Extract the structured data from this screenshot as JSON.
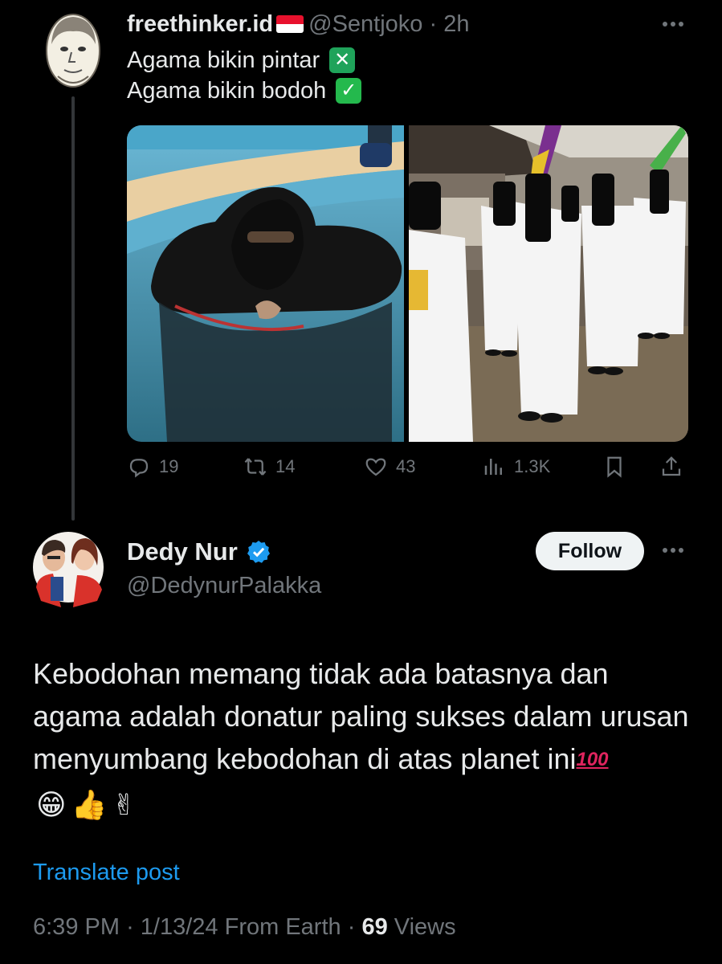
{
  "parent_tweet": {
    "display_name": "freethinker.id",
    "handle": "@Sentjoko",
    "separator": "·",
    "time": "2h",
    "lines": [
      {
        "text": "Agama bikin pintar",
        "mark": "✕"
      },
      {
        "text": "Agama bikin bodoh",
        "mark": "✓"
      }
    ],
    "media": [
      {
        "name": "photo-woman-in-niqab-in-pool"
      },
      {
        "name": "photo-veiled-girls-in-white-uniforms"
      }
    ],
    "stats": {
      "replies": "19",
      "reposts": "14",
      "likes": "43",
      "views": "1.3K"
    },
    "icons": [
      "reply-icon",
      "repost-icon",
      "like-icon",
      "views-icon",
      "bookmark-icon",
      "share-icon"
    ]
  },
  "reply_tweet": {
    "display_name": "Dedy Nur",
    "handle": "@DedynurPalakka",
    "follow_label": "Follow",
    "body": "Kebodohan memang tidak ada batasnya dan agama adalah donatur paling sukses dalam urusan menyumbang kebodohan di atas planet ini",
    "emoji_hundred": "100",
    "emojis": [
      "😁",
      "👍",
      "✌"
    ],
    "translate_label": "Translate post",
    "time": "6:39 PM",
    "date": "1/13/24",
    "source": "From Earth",
    "views_count": "69",
    "views_label": "Views",
    "dot": "·"
  },
  "colors": {
    "background": "#000000",
    "text_primary": "#e7e9ea",
    "text_secondary": "#71767b",
    "link": "#1d9bf0",
    "verified": "#1d9bf0",
    "thread_line": "#333639"
  }
}
